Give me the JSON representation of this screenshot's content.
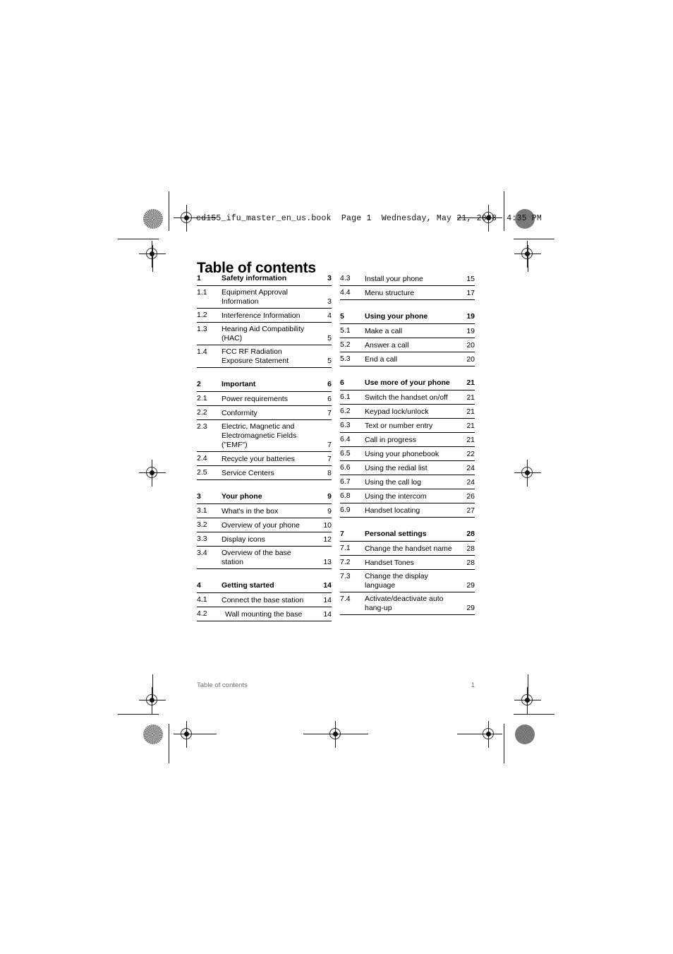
{
  "file_stamp": "cd155_ifu_master_en_us.book  Page 1  Wednesday, May 21, 2008  4:35 PM",
  "page_title": "Table of contents",
  "footer": {
    "left": "Table of contents",
    "right": "1"
  },
  "colors": {
    "text": "#000000",
    "footer_text": "#6f6f6f",
    "rule": "#000000",
    "page_background": "#ffffff"
  },
  "toc": {
    "left_column": [
      {
        "num": "1",
        "label": "Safety information",
        "page": "3",
        "level": 1,
        "lines": 1
      },
      {
        "num": "1.1",
        "label": "Equipment Approval Information",
        "page": "3",
        "level": 2,
        "lines": 2
      },
      {
        "num": "1.2",
        "label": "Interference Information",
        "page": "4",
        "level": 2,
        "lines": 1
      },
      {
        "num": "1.3",
        "label": "Hearing Aid Compatibility (HAC)",
        "page": "5",
        "level": 2,
        "lines": 2
      },
      {
        "num": "1.4",
        "label": "FCC RF Radiation Exposure Statement",
        "page": "5",
        "level": 2,
        "lines": 2
      },
      {
        "num": "2",
        "label": "Important",
        "page": "6",
        "level": 1,
        "lines": 1
      },
      {
        "num": "2.1",
        "label": "Power requirements",
        "page": "6",
        "level": 2,
        "lines": 1
      },
      {
        "num": "2.2",
        "label": "Conformity",
        "page": "7",
        "level": 2,
        "lines": 1
      },
      {
        "num": "2.3",
        "label": "Electric, Magnetic and Electromagnetic Fields (\"EMF\")",
        "page": "7",
        "level": 2,
        "lines": 2
      },
      {
        "num": "2.4",
        "label": "Recycle your batteries",
        "page": "7",
        "level": 2,
        "lines": 1
      },
      {
        "num": "2.5",
        "label": "Service Centers",
        "page": "8",
        "level": 2,
        "lines": 1
      },
      {
        "num": "3",
        "label": "Your phone",
        "page": "9",
        "level": 1,
        "lines": 1
      },
      {
        "num": "3.1",
        "label": "What's in the box",
        "page": "9",
        "level": 2,
        "lines": 1
      },
      {
        "num": "3.2",
        "label": "Overview of your phone",
        "page": "10",
        "level": 2,
        "lines": 1
      },
      {
        "num": "3.3",
        "label": "Display icons",
        "page": "12",
        "level": 2,
        "lines": 1
      },
      {
        "num": "3.4",
        "label": "Overview of the base station",
        "page": "13",
        "level": 2,
        "lines": 1
      },
      {
        "num": "4",
        "label": "Getting started",
        "page": "14",
        "level": 1,
        "lines": 1
      },
      {
        "num": "4.1",
        "label": "Connect the base station",
        "page": "14",
        "level": 2,
        "lines": 1
      },
      {
        "num": "4.2",
        "label": "Wall mounting the base",
        "page": "14",
        "level": 2,
        "lines": 1,
        "indent": true
      }
    ],
    "right_column": [
      {
        "num": "4.3",
        "label": "Install your phone",
        "page": "15",
        "level": 2,
        "lines": 1
      },
      {
        "num": "4.4",
        "label": "Menu structure",
        "page": "17",
        "level": 2,
        "lines": 1
      },
      {
        "num": "5",
        "label": "Using your phone",
        "page": "19",
        "level": 1,
        "lines": 1
      },
      {
        "num": "5.1",
        "label": "Make a call",
        "page": "19",
        "level": 2,
        "lines": 1
      },
      {
        "num": "5.2",
        "label": "Answer a call",
        "page": "20",
        "level": 2,
        "lines": 1
      },
      {
        "num": "5.3",
        "label": "End a call",
        "page": "20",
        "level": 2,
        "lines": 1
      },
      {
        "num": "6",
        "label": "Use more of your phone",
        "page": "21",
        "level": 1,
        "lines": 1
      },
      {
        "num": "6.1",
        "label": "Switch the handset on/off",
        "page": "21",
        "level": 2,
        "lines": 1
      },
      {
        "num": "6.2",
        "label": "Keypad lock/unlock",
        "page": "21",
        "level": 2,
        "lines": 1
      },
      {
        "num": "6.3",
        "label": "Text or number entry",
        "page": "21",
        "level": 2,
        "lines": 1
      },
      {
        "num": "6.4",
        "label": "Call in progress",
        "page": "21",
        "level": 2,
        "lines": 1
      },
      {
        "num": "6.5",
        "label": "Using your phonebook",
        "page": "22",
        "level": 2,
        "lines": 1
      },
      {
        "num": "6.6",
        "label": "Using the redial list",
        "page": "24",
        "level": 2,
        "lines": 1
      },
      {
        "num": "6.7",
        "label": "Using the call log",
        "page": "24",
        "level": 2,
        "lines": 1
      },
      {
        "num": "6.8",
        "label": "Using the intercom",
        "page": "26",
        "level": 2,
        "lines": 1
      },
      {
        "num": "6.9",
        "label": "Handset locating",
        "page": "27",
        "level": 2,
        "lines": 1
      },
      {
        "num": "7",
        "label": "Personal settings",
        "page": "28",
        "level": 1,
        "lines": 1
      },
      {
        "num": "7.1",
        "label": "Change the handset name",
        "page": "28",
        "level": 2,
        "lines": 1
      },
      {
        "num": "7.2",
        "label": "Handset Tones",
        "page": "28",
        "level": 2,
        "lines": 1
      },
      {
        "num": "7.3",
        "label": "Change the display language",
        "page": "29",
        "level": 2,
        "lines": 1
      },
      {
        "num": "7.4",
        "label": "Activate/deactivate auto hang-up",
        "page": "29",
        "level": 2,
        "lines": 2
      }
    ]
  }
}
